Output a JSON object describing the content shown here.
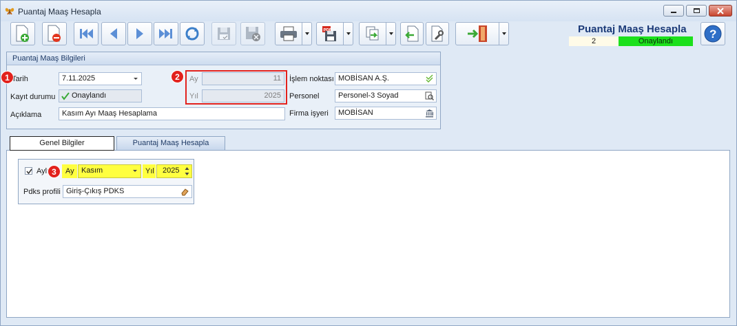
{
  "window": {
    "title": "Puantaj Maaş Hesapla"
  },
  "header": {
    "title": "Puantaj Maaş Hesapla",
    "record_no": "2",
    "status": "Onaylandı",
    "status_color": "#1ce01c"
  },
  "toolbar": {
    "buttons": [
      "new-document",
      "delete-document",
      "first-record",
      "previous-record",
      "next-record",
      "last-record",
      "refresh",
      "save",
      "save-and-close",
      "print",
      "export-pdf",
      "copy",
      "import",
      "tools",
      "exit"
    ]
  },
  "group": {
    "title": "Puantaj Maaş Bilgileri",
    "tarih_label": "Tarih",
    "tarih_value": "7.11.2025",
    "kayit_label": "Kayıt durumu",
    "kayit_value": "Onaylandı",
    "aciklama_label": "Açıklama",
    "aciklama_value": "Kasım Ayı Maaş Hesaplama",
    "ay_label": "Ay",
    "ay_value": "11",
    "yil_label": "Yıl",
    "yil_value": "2025",
    "islem_label": "İşlem noktası",
    "islem_value": "MOBİSAN A.Ş.",
    "personel_label": "Personel",
    "personel_value": "Personel-3 Soyad",
    "firma_label": "Firma işyeri",
    "firma_value": "MOBİSAN"
  },
  "markers": [
    "1",
    "2",
    "3"
  ],
  "tabs": [
    "Genel Bilgiler",
    "Puantaj Maaş Hesapla"
  ],
  "genel": {
    "aylik_label": "Aylı",
    "aylik_checked": true,
    "ay_label": "Ay",
    "ay_value": "Kasım",
    "yil_label": "Yıl",
    "yil_value": "2025",
    "pdks_label": "Pdks profili",
    "pdks_value": "Giriş-Çıkış PDKS"
  }
}
